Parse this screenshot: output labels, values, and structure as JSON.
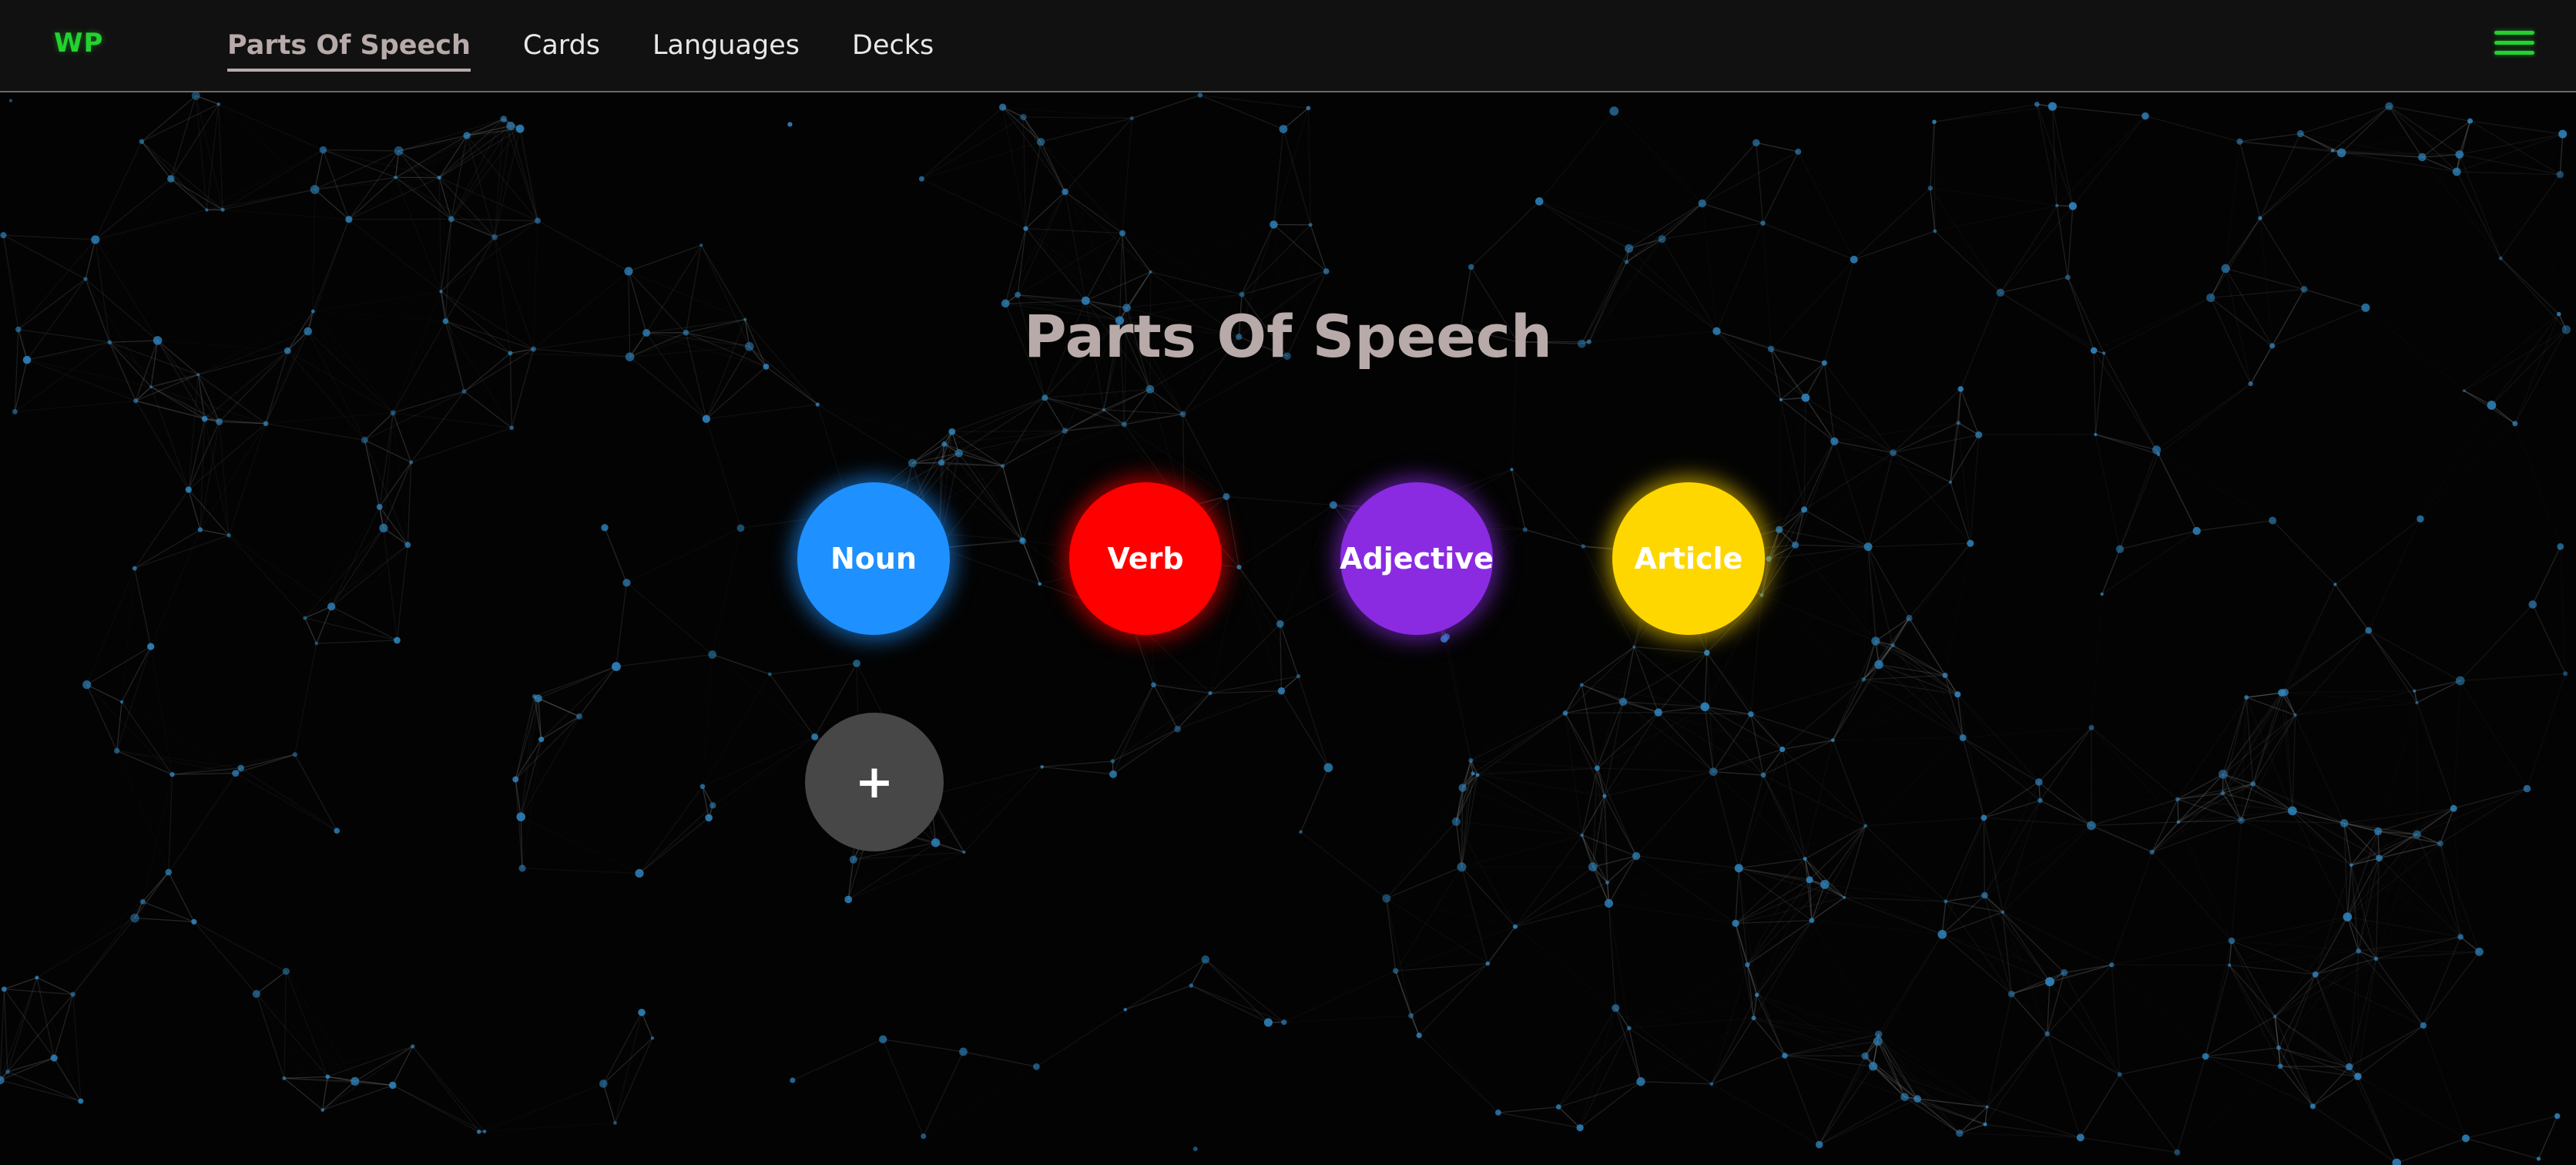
{
  "app": {
    "logo": "WP",
    "logo_color": "#22d32f"
  },
  "nav": {
    "links": [
      {
        "label": "Parts Of Speech",
        "active": true
      },
      {
        "label": "Cards",
        "active": false
      },
      {
        "label": "Languages",
        "active": false
      },
      {
        "label": "Decks",
        "active": false
      }
    ],
    "menu_icon": "hamburger-menu-icon"
  },
  "main": {
    "title": "Parts Of Speech",
    "parts_of_speech": [
      {
        "label": "Noun",
        "color": "#1e90ff"
      },
      {
        "label": "Verb",
        "color": "#ff0000"
      },
      {
        "label": "Adjective",
        "color": "#8a2be2"
      },
      {
        "label": "Article",
        "color": "#ffd700"
      }
    ],
    "add_button": {
      "label": "+",
      "color": "#474747"
    }
  },
  "background": {
    "type": "particle-network",
    "node_color": "#2e86c1",
    "line_color": "#9a9a9a"
  }
}
